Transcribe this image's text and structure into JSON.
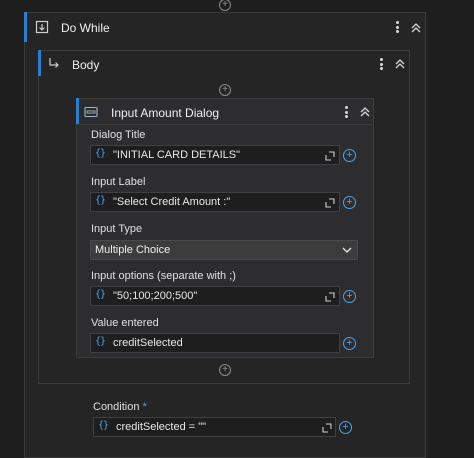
{
  "do_while": {
    "title": "Do While",
    "body": {
      "title": "Body",
      "dialog": {
        "title": "Input Amount Dialog",
        "dialog_title": {
          "label": "Dialog Title",
          "value": "\"INITIAL CARD DETAILS\""
        },
        "input_label": {
          "label": "Input Label",
          "value": "\"Select Credit Amount :\""
        },
        "input_type": {
          "label": "Input Type",
          "value": "Multiple Choice"
        },
        "input_options": {
          "label": "Input options (separate with ;)",
          "value": "\"50;100;200;500\""
        },
        "value_entered": {
          "label": "Value entered",
          "value": "creditSelected"
        }
      }
    },
    "condition": {
      "label": "Condition",
      "required_mark": "*",
      "value": "creditSelected = \"\""
    }
  },
  "icons": {
    "expression_icon": "{}",
    "add": "+",
    "accent_color": "#2b7fd1",
    "brace_color": "#4aa3f0"
  }
}
